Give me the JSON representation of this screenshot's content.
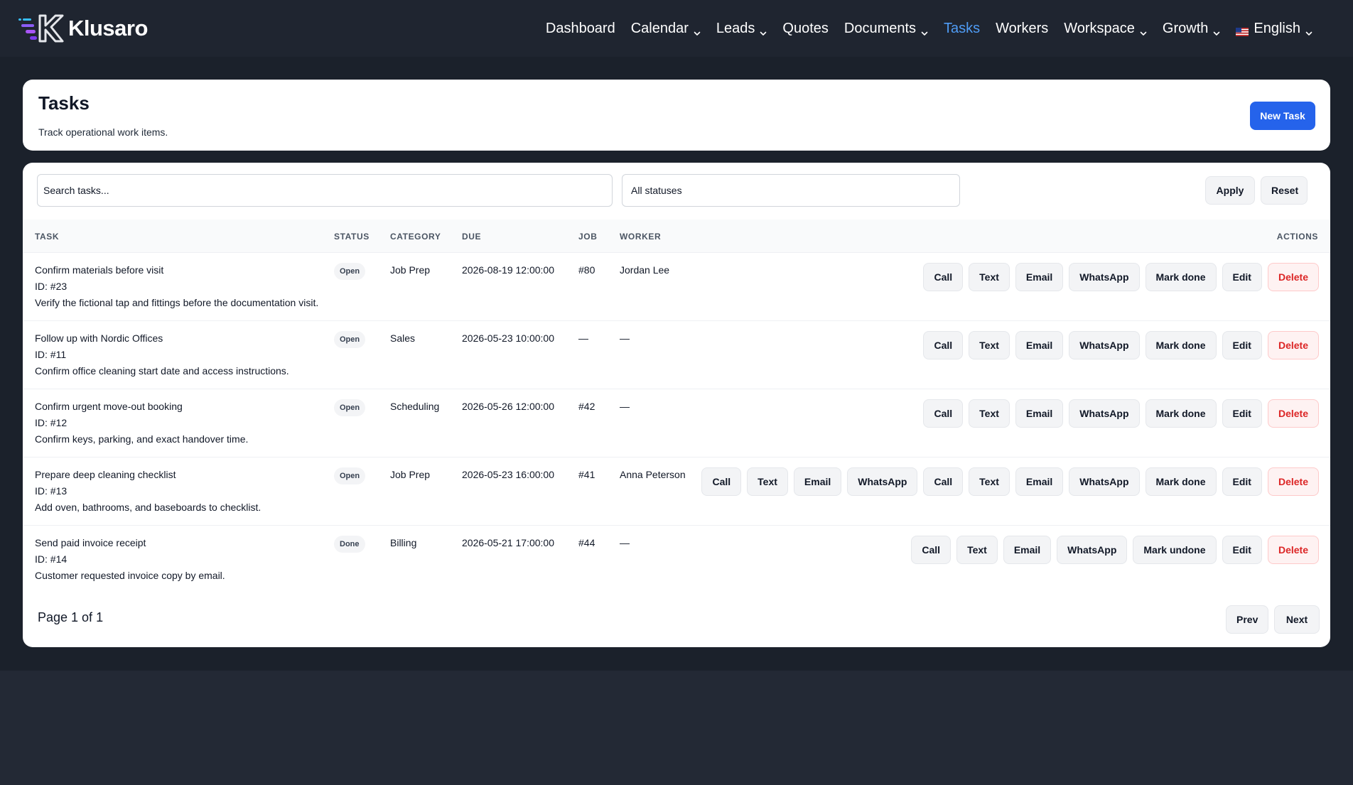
{
  "app": {
    "brand_name": "Klusaro",
    "colors": {
      "accent": "#2563eb",
      "nav_active": "#4f9cf5",
      "danger": "#dc2626",
      "topbar": "#1f2530"
    }
  },
  "nav": {
    "items": [
      {
        "label": "Dashboard",
        "dropdown": false,
        "active": false
      },
      {
        "label": "Calendar",
        "dropdown": true,
        "active": false
      },
      {
        "label": "Leads",
        "dropdown": true,
        "active": false
      },
      {
        "label": "Quotes",
        "dropdown": false,
        "active": false
      },
      {
        "label": "Documents",
        "dropdown": true,
        "active": false
      },
      {
        "label": "Tasks",
        "dropdown": false,
        "active": true
      },
      {
        "label": "Workers",
        "dropdown": false,
        "active": false
      },
      {
        "label": "Workspace",
        "dropdown": true,
        "active": false
      },
      {
        "label": "Growth",
        "dropdown": true,
        "active": false
      }
    ],
    "language": {
      "label": "English",
      "flag_icon": "us-flag-icon"
    }
  },
  "header": {
    "title": "Tasks",
    "subtitle": "Track operational work items.",
    "new_task_label": "New Task"
  },
  "filters": {
    "search_placeholder": "Search tasks...",
    "status_value": "All statuses",
    "apply_label": "Apply",
    "reset_label": "Reset"
  },
  "table": {
    "columns": {
      "task": "Task",
      "status": "Status",
      "category": "Category",
      "due": "Due",
      "job": "Job",
      "worker": "Worker",
      "actions": "Actions"
    },
    "rows": [
      {
        "title": "Confirm materials before visit",
        "id": "ID: #23",
        "description": "Verify the fictional tap and fittings before the documentation visit.",
        "status": "Open",
        "category": "Job Prep",
        "due": "2026-08-19 12:00:00",
        "job": "#80",
        "worker": "Jordan Lee",
        "actions": [
          "Call",
          "Text",
          "Email",
          "WhatsApp",
          "Mark done",
          "Edit",
          "Delete"
        ]
      },
      {
        "title": "Follow up with Nordic Offices",
        "id": "ID: #11",
        "description": "Confirm office cleaning start date and access instructions.",
        "status": "Open",
        "category": "Sales",
        "due": "2026-05-23 10:00:00",
        "job": "—",
        "worker": "—",
        "actions": [
          "Call",
          "Text",
          "Email",
          "WhatsApp",
          "Mark done",
          "Edit",
          "Delete"
        ]
      },
      {
        "title": "Confirm urgent move-out booking",
        "id": "ID: #12",
        "description": "Confirm keys, parking, and exact handover time.",
        "status": "Open",
        "category": "Scheduling",
        "due": "2026-05-26 12:00:00",
        "job": "#42",
        "worker": "—",
        "actions": [
          "Call",
          "Text",
          "Email",
          "WhatsApp",
          "Mark done",
          "Edit",
          "Delete"
        ]
      },
      {
        "title": "Prepare deep cleaning checklist",
        "id": "ID: #13",
        "description": "Add oven, bathrooms, and baseboards to checklist.",
        "status": "Open",
        "category": "Job Prep",
        "due": "2026-05-23 16:00:00",
        "job": "#41",
        "worker": "Anna Peterson",
        "actions": [
          "Call",
          "Text",
          "Email",
          "WhatsApp",
          "Call",
          "Text",
          "Email",
          "WhatsApp",
          "Mark done",
          "Edit",
          "Delete"
        ]
      },
      {
        "title": "Send paid invoice receipt",
        "id": "ID: #14",
        "description": "Customer requested invoice copy by email.",
        "status": "Done",
        "category": "Billing",
        "due": "2026-05-21 17:00:00",
        "job": "#44",
        "worker": "—",
        "actions": [
          "Call",
          "Text",
          "Email",
          "WhatsApp",
          "Mark undone",
          "Edit",
          "Delete"
        ]
      }
    ]
  },
  "pagination": {
    "label": "Page 1 of 1",
    "prev_label": "Prev",
    "next_label": "Next"
  }
}
